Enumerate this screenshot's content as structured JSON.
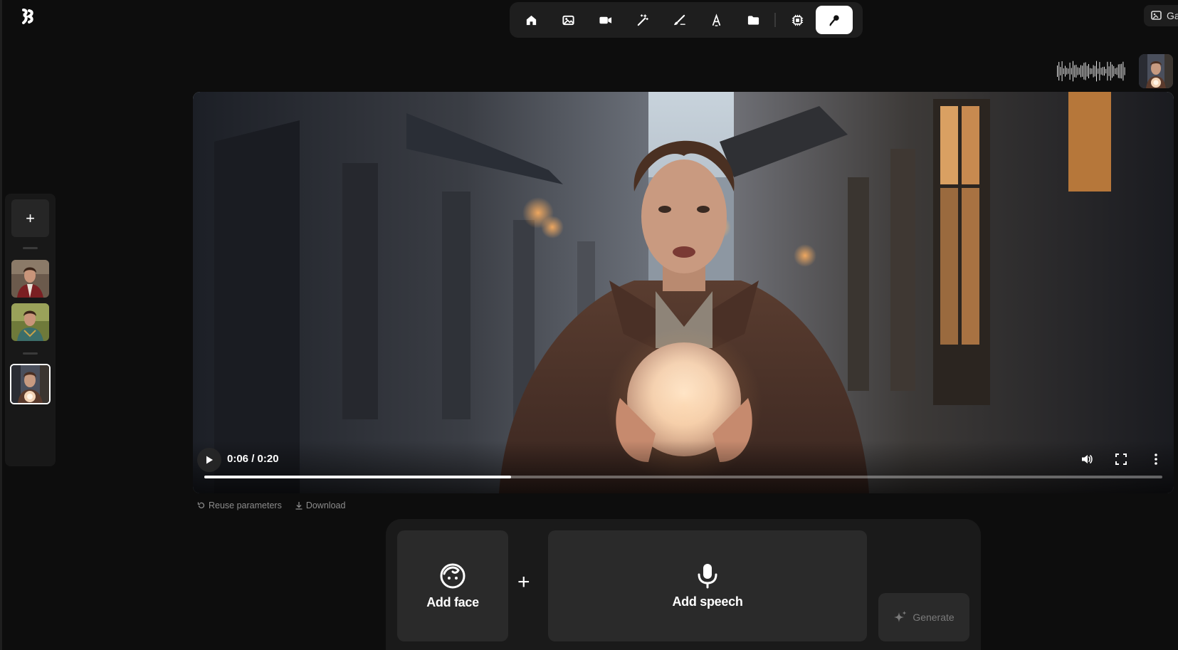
{
  "toolbar": {
    "items": [
      {
        "icon": "home-icon"
      },
      {
        "icon": "image-icon"
      },
      {
        "icon": "video-icon"
      },
      {
        "icon": "magic-wand-icon"
      },
      {
        "icon": "brush-icon"
      },
      {
        "icon": "text-tool-icon"
      },
      {
        "icon": "folder-icon"
      },
      {
        "icon": "chip-icon"
      },
      {
        "icon": "microphone-icon",
        "active": true
      }
    ]
  },
  "top_right": {
    "label": "Ga"
  },
  "player": {
    "timecode": "0:06 / 0:20",
    "progress": 0.32
  },
  "video_actions": {
    "reuse_label": "Reuse parameters",
    "download_label": "Download"
  },
  "composer": {
    "add_face_label": "Add face",
    "plus": "+",
    "add_speech_label": "Add speech",
    "generate_label": "Generate"
  },
  "history": {
    "add_label": "+"
  },
  "colors": {
    "background": "#0d0d0d",
    "panel": "#1e1e1e",
    "card": "#2a2a2a",
    "active_tool": "#ffffff"
  }
}
